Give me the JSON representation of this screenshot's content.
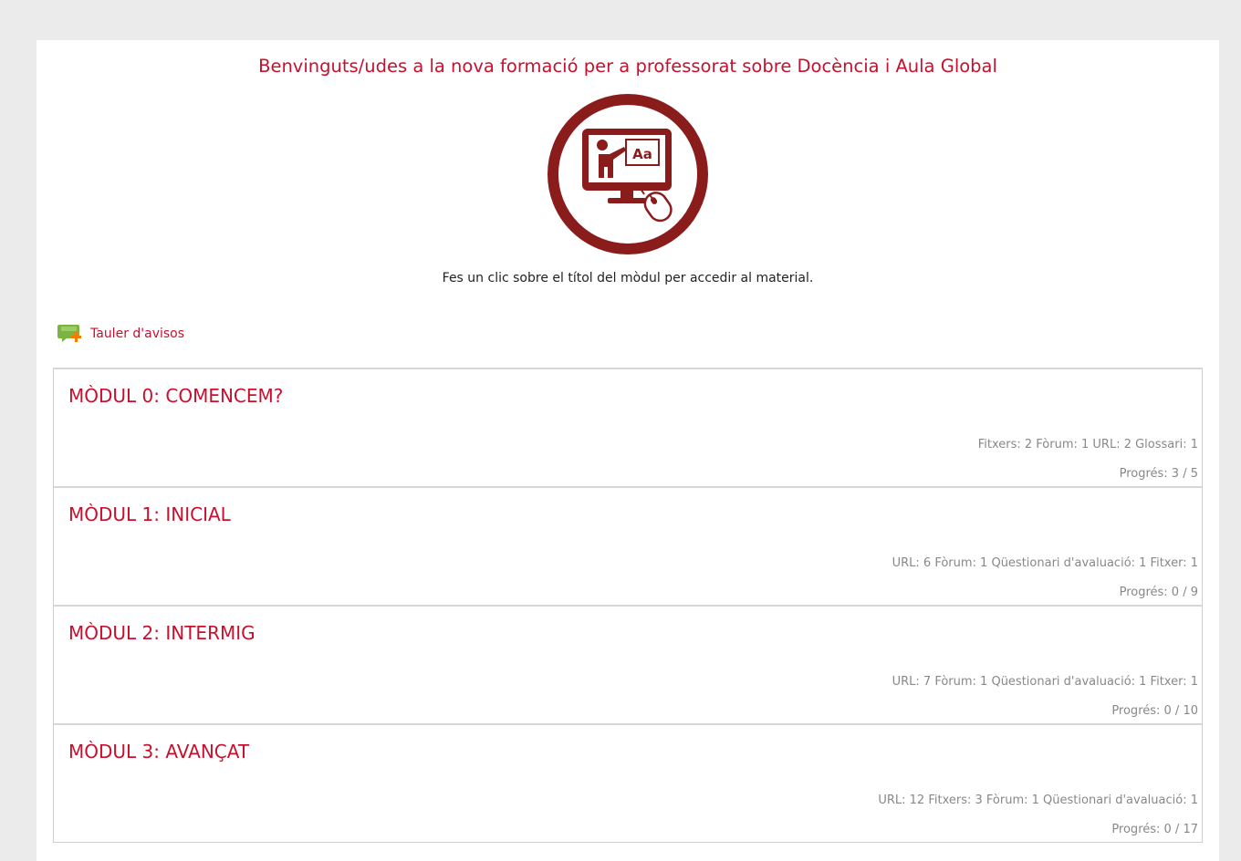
{
  "header": {
    "welcome": "Benvinguts/udes a la nova formació per a professorat sobre Docència i Aula Global",
    "logo_text": "Aa",
    "intro": "Fes un clic sobre el títol del mòdul per accedir al material."
  },
  "notice": {
    "label": "Tauler d'avisos",
    "icon": "chat-bubble-add-icon"
  },
  "modules": [
    {
      "title": "MÒDUL 0: COMENCEM?",
      "meta": "Fitxers: 2 Fòrum: 1 URL: 2 Glossari: 1",
      "progress": "Progrés: 3 / 5"
    },
    {
      "title": "MÒDUL 1: INICIAL",
      "meta": "URL: 6 Fòrum: 1 Qüestionari d'avaluació: 1 Fitxer: 1",
      "progress": "Progrés: 0 / 9"
    },
    {
      "title": "MÒDUL 2: INTERMIG",
      "meta": "URL: 7 Fòrum: 1 Qüestionari d'avaluació: 1 Fitxer: 1",
      "progress": "Progrés: 0 / 10"
    },
    {
      "title": "MÒDUL 3: AVANÇAT",
      "meta": "URL: 12 Fitxers: 3 Fòrum: 1 Qüestionari d'avaluació: 1",
      "progress": "Progrés: 0 / 17"
    }
  ],
  "colors": {
    "accent": "#c8102e",
    "logo": "#8b1c1c",
    "background": "#ebebeb",
    "muted": "#888888"
  }
}
